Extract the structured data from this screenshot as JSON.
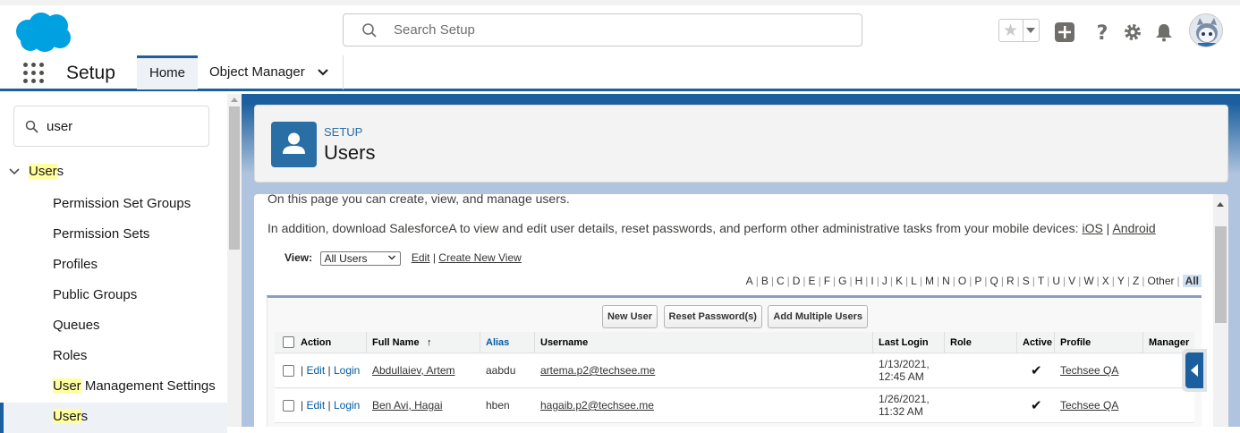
{
  "header": {
    "search_placeholder": "Search Setup"
  },
  "nav": {
    "app_title": "Setup",
    "tabs": [
      {
        "label": "Home"
      },
      {
        "label": "Object Manager"
      }
    ]
  },
  "sidebar": {
    "quick_find_value": "user",
    "parent_pre": "",
    "parent_hl": "User",
    "parent_post": "s",
    "items": [
      {
        "pre": "Permission Set Groups",
        "hl": "",
        "post": ""
      },
      {
        "pre": "Permission Sets",
        "hl": "",
        "post": ""
      },
      {
        "pre": "Profiles",
        "hl": "",
        "post": ""
      },
      {
        "pre": "Public Groups",
        "hl": "",
        "post": ""
      },
      {
        "pre": "Queues",
        "hl": "",
        "post": ""
      },
      {
        "pre": "Roles",
        "hl": "",
        "post": ""
      },
      {
        "pre": "",
        "hl": "User",
        "post": " Management Settings"
      },
      {
        "pre": "",
        "hl": "User",
        "post": "s"
      }
    ]
  },
  "page_header": {
    "eyebrow": "SETUP",
    "title": "Users"
  },
  "content": {
    "intro1": "On this page you can create, view, and manage users.",
    "intro2_text": "In addition, download SalesforceA to view and edit user details, reset passwords, and perform other administrative tasks from your mobile devices: ",
    "intro2_ios": "iOS",
    "intro2_sep": " | ",
    "intro2_android": "Android",
    "view_label": "View:",
    "view_selected": "All Users",
    "edit_link": "Edit",
    "link_sep": " | ",
    "create_view_link": "Create New View",
    "alphabet": [
      "A",
      "B",
      "C",
      "D",
      "E",
      "F",
      "G",
      "H",
      "I",
      "J",
      "K",
      "L",
      "M",
      "N",
      "O",
      "P",
      "Q",
      "R",
      "S",
      "T",
      "U",
      "V",
      "W",
      "X",
      "Y",
      "Z",
      "Other"
    ],
    "alphabet_selected": "All",
    "buttons": {
      "new_user": "New User",
      "reset_password": "Reset Password(s)",
      "add_multiple": "Add Multiple Users"
    },
    "columns": [
      "Action",
      "Full Name",
      "↑",
      "Alias",
      "Username",
      "Last Login",
      "Role",
      "Active",
      "Profile",
      "Manager"
    ],
    "rows": [
      {
        "action_edit": "Edit",
        "action_login": "Login",
        "pipe1": "|",
        "pipe2": "|",
        "full_name": "Abdullaiev, Artem",
        "alias": "aabdu",
        "username": "artema.p2@techsee.me",
        "last_login_date": "1/13/2021,",
        "last_login_time": "12:45 AM",
        "role": "",
        "active": "✔",
        "profile": "Techsee QA",
        "manager": ""
      },
      {
        "action_edit": "Edit",
        "action_login": "Login",
        "pipe1": "|",
        "pipe2": "|",
        "full_name": "Ben Avi, Hagai",
        "alias": "hben",
        "username": "hagaib.p2@techsee.me",
        "last_login_date": "1/26/2021,",
        "last_login_time": "11:32 AM",
        "role": "",
        "active": "✔",
        "profile": "Techsee QA",
        "manager": ""
      }
    ]
  },
  "colors": {
    "brand": "#1b5f9e",
    "icon_bg": "#2a6ea6",
    "logo": "#00a1e0",
    "highlight": "#ffffa0"
  }
}
